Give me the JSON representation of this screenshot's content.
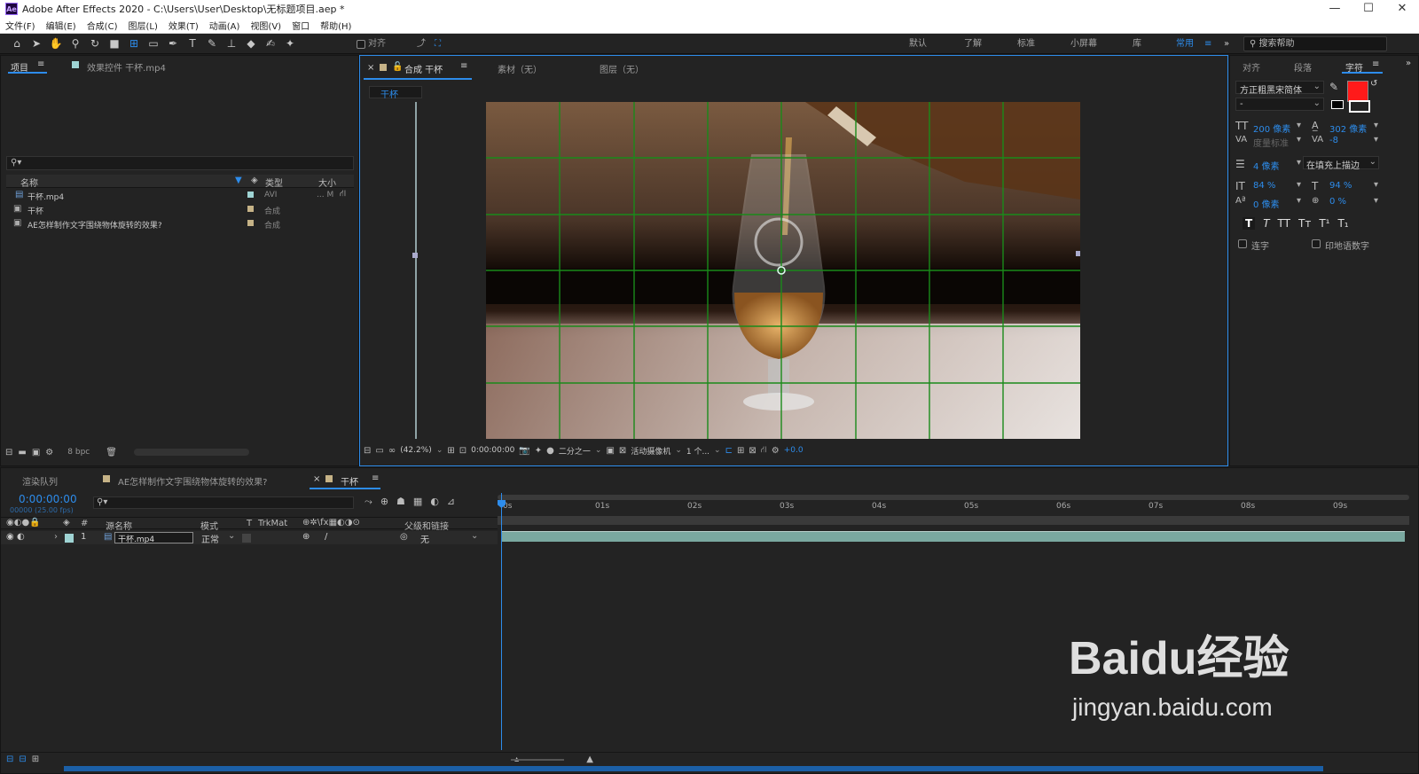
{
  "app": {
    "logo_text": "Ae",
    "title": "Adobe After Effects 2020 - C:\\Users\\User\\Desktop\\无标题项目.aep *",
    "window_controls": [
      "—",
      "☐",
      "✕"
    ]
  },
  "menu": [
    "文件(F)",
    "编辑(E)",
    "合成(C)",
    "图层(L)",
    "效果(T)",
    "动画(A)",
    "视图(V)",
    "窗口",
    "帮助(H)"
  ],
  "toolbar": {
    "align_label": "对齐",
    "workspaces": [
      "默认",
      "了解",
      "标准",
      "小屏幕",
      "库",
      "常用"
    ],
    "active_workspace": "常用",
    "search_help": "搜索帮助"
  },
  "project_panel": {
    "tabs": [
      "项目",
      "效果控件 干杯.mp4"
    ],
    "search_placeholder": "",
    "columns": [
      "名称",
      "类型",
      "大小"
    ],
    "items": [
      {
        "name": "干杯.mp4",
        "type": "AVI",
        "size": "... M",
        "label_color": "#9fd4d4"
      },
      {
        "name": "干杯",
        "type": "合成",
        "size": "",
        "label_color": "#c6b387"
      },
      {
        "name": "AE怎样制作文字围绕物体旋转的效果?",
        "type": "合成",
        "size": "",
        "label_color": "#c6b387"
      }
    ],
    "bpc": "8 bpc"
  },
  "comp_panel": {
    "tabs": [
      "合成 干杯",
      "素材（无）",
      "图层（无）"
    ],
    "breadcrumb": "干杯",
    "zoom": "(42.2%)",
    "timecode": "0:00:00:00",
    "resolution": "二分之一",
    "camera": "活动摄像机",
    "views": "1 个...",
    "exposure": "+0.0"
  },
  "character_panel": {
    "tabs": [
      "对齐",
      "段落",
      "字符"
    ],
    "font_family": "方正粗黑宋简体",
    "font_style": "-",
    "fill_color": "#ff1a1a",
    "font_size": "200 像素",
    "leading": "302 像素",
    "kerning": "度量标准",
    "tracking": "-8",
    "stroke_width": "4 像素",
    "stroke_mode": "在填充上描边",
    "vertical_scale": "84 %",
    "horizontal_scale": "94 %",
    "baseline_shift": "0 像素",
    "tsume": "0 %",
    "style_buttons": [
      "T",
      "T",
      "TT",
      "Tт",
      "T¹",
      "T₁"
    ],
    "ligatures_label": "连字",
    "hindi_digits_label": "印地语数字"
  },
  "timeline": {
    "tabs": [
      "渲染队列",
      "AE怎样制作文字围绕物体旋转的效果?",
      "干杯"
    ],
    "timecode": "0:00:00:00",
    "frame_info": "00000 (25.00 fps)",
    "columns": [
      "#",
      "源名称",
      "模式",
      "T",
      "TrkMat",
      "父级和链接"
    ],
    "ruler": [
      "0s",
      "01s",
      "02s",
      "03s",
      "04s",
      "05s",
      "06s",
      "07s",
      "08s",
      "09s"
    ],
    "layers": [
      {
        "index": "1",
        "name": "干杯.mp4",
        "mode": "正常",
        "parent": "无"
      }
    ]
  },
  "watermark": {
    "brand": "Baidu经验",
    "url": "jingyan.baidu.com"
  }
}
